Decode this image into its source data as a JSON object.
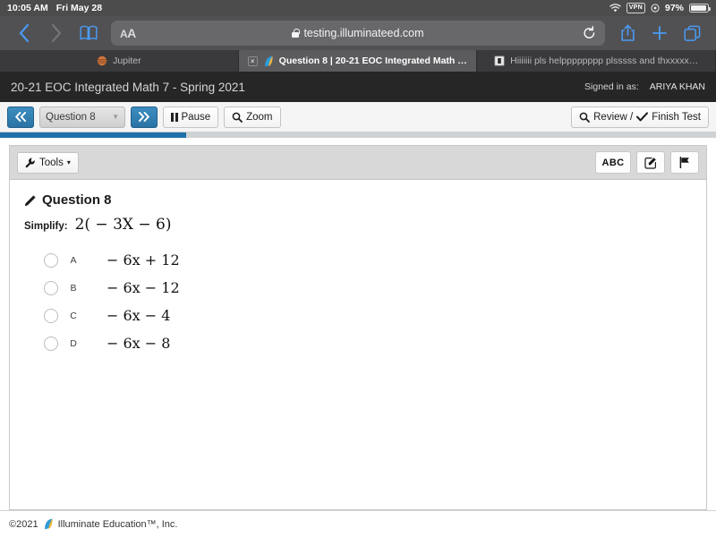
{
  "status_bar": {
    "time": "10:05 AM",
    "date": "Fri May 28",
    "wifi_icon": "wifi-icon",
    "vpn_label": "VPN",
    "location_icon": "location-icon",
    "battery_percent": "97%",
    "battery_icon": "battery-icon"
  },
  "browser": {
    "back_icon": "chevron-left-icon",
    "forward_icon": "chevron-right-icon",
    "bookmarks_icon": "book-icon",
    "reader_label": "AA",
    "url": "testing.illuminateed.com",
    "lock_icon": "lock-icon",
    "reload_icon": "reload-icon",
    "share_icon": "share-icon",
    "new_tab_icon": "plus-icon",
    "tabs_icon": "tabs-icon",
    "tabs": [
      {
        "title": "Jupiter",
        "favicon": "jupiter-planet-icon",
        "active": false,
        "closable": false
      },
      {
        "title": "Question 8 | 20-21 EOC Integrated Math 7 -…",
        "favicon": "illuminate-leaf-icon",
        "active": true,
        "closable": true,
        "close_label": "×"
      },
      {
        "title": "Hiiiiiii pls helpppppppp plsssss and thxxxxx…",
        "favicon": "document-icon",
        "active": false,
        "closable": false
      }
    ]
  },
  "app_header": {
    "title": "20-21 EOC Integrated Math 7 - Spring 2021",
    "signed_in_label": "Signed in as:",
    "user_name": "ARIYA KHAN"
  },
  "test_toolbar": {
    "prev_icon": "double-chevron-left-icon",
    "next_icon": "double-chevron-right-icon",
    "question_select_value": "Question 8",
    "select_caret_icon": "chevron-down-icon",
    "pause_label": "Pause",
    "pause_icon": "pause-icon",
    "zoom_label": "Zoom",
    "zoom_icon": "magnifier-icon",
    "review_finish_label_a": "Review /",
    "review_finish_label_b": "Finish Test",
    "review_icon": "magnifier-icon",
    "finish_icon": "check-icon",
    "progress_percent": 26
  },
  "question_panel": {
    "tools_label": "Tools",
    "tools_icon": "wrench-icon",
    "tools_caret": "▾",
    "abc_label": "ABC",
    "edit_icon": "pencil-square-icon",
    "flag_icon": "flag-icon",
    "question_title": "Question 8",
    "question_icon": "pencil-icon",
    "prompt_label": "Simplify:",
    "prompt_math": "2( − 3X − 6)",
    "choices": [
      {
        "letter": "A",
        "math": "− 6x + 12",
        "selected": false
      },
      {
        "letter": "B",
        "math": "− 6x − 12",
        "selected": false
      },
      {
        "letter": "C",
        "math": "− 6x − 4",
        "selected": false
      },
      {
        "letter": "D",
        "math": "− 6x − 8",
        "selected": false
      }
    ]
  },
  "footer": {
    "copyright": "©2021",
    "company": "Illuminate Education™, Inc.",
    "logo_icon": "illuminate-leaf-icon"
  },
  "colors": {
    "accent_blue": "#1e72a8",
    "toolbar_blue": "#2f7cb0",
    "header_dark": "#262626",
    "chrome_gray": "#515154"
  }
}
